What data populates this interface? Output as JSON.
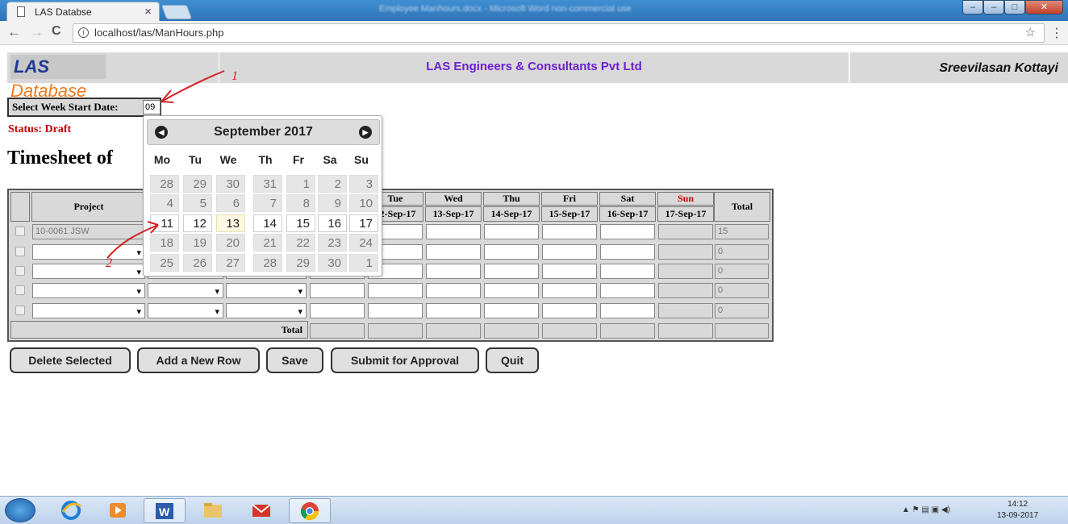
{
  "browser": {
    "tab_title": "LAS Databse",
    "tab_close": "×",
    "window_title": "Employee Manhours.docx - Microsoft Word non-commercial use",
    "url": "localhost/las/ManHours.php",
    "back": "←",
    "forward": "→",
    "reload": "C",
    "info": "i",
    "star": "☆",
    "menu": "⋮"
  },
  "header": {
    "logo_las": "LAS",
    "logo_db": "Database",
    "company": "LAS Engineers & Consultants Pvt Ltd",
    "user": "Sreevilasan Kottayi"
  },
  "week_selector": {
    "label": "Select Week Start Date:",
    "value": "09"
  },
  "status": "Status: Draft",
  "timesheet_title": "Timesheet of",
  "table": {
    "project_header": "Project",
    "days": [
      {
        "name": "Tue",
        "date": "12-Sep-17"
      },
      {
        "name": "Wed",
        "date": "13-Sep-17"
      },
      {
        "name": "Thu",
        "date": "14-Sep-17"
      },
      {
        "name": "Fri",
        "date": "15-Sep-17"
      },
      {
        "name": "Sat",
        "date": "16-Sep-17"
      },
      {
        "name": "Sun",
        "date": "17-Sep-17"
      }
    ],
    "total_header": "Total",
    "rows": [
      {
        "project": "10-0061 JSW",
        "total": "15"
      },
      {
        "project": "",
        "total": "0"
      },
      {
        "project": "",
        "total": "0"
      },
      {
        "project": "",
        "total": "0"
      },
      {
        "project": "",
        "total": "0"
      }
    ],
    "total_row_label": "Total",
    "sun_color": "#cc0000"
  },
  "buttons": {
    "delete": "Delete Selected",
    "add_row": "Add a New Row",
    "save": "Save",
    "submit": "Submit for Approval",
    "quit": "Quit"
  },
  "calendar": {
    "month_title": "September 2017",
    "prev_icon": "◀",
    "next_icon": "▶",
    "weekdays": [
      "Mo",
      "Tu",
      "We",
      "Th",
      "Fr",
      "Sa",
      "Su"
    ],
    "weeks": [
      [
        {
          "d": "28",
          "cur": false
        },
        {
          "d": "29",
          "cur": false
        },
        {
          "d": "30",
          "cur": false
        },
        {
          "d": "31",
          "cur": false
        },
        {
          "d": "1",
          "cur": false
        },
        {
          "d": "2",
          "cur": false
        },
        {
          "d": "3",
          "cur": false
        }
      ],
      [
        {
          "d": "4",
          "cur": false
        },
        {
          "d": "5",
          "cur": false
        },
        {
          "d": "6",
          "cur": false
        },
        {
          "d": "7",
          "cur": false
        },
        {
          "d": "8",
          "cur": false
        },
        {
          "d": "9",
          "cur": false
        },
        {
          "d": "10",
          "cur": false
        }
      ],
      [
        {
          "d": "11",
          "cur": true
        },
        {
          "d": "12",
          "cur": true
        },
        {
          "d": "13",
          "cur": true,
          "today": true
        },
        {
          "d": "14",
          "cur": true
        },
        {
          "d": "15",
          "cur": true
        },
        {
          "d": "16",
          "cur": true
        },
        {
          "d": "17",
          "cur": true
        }
      ],
      [
        {
          "d": "18",
          "cur": false
        },
        {
          "d": "19",
          "cur": false
        },
        {
          "d": "20",
          "cur": false
        },
        {
          "d": "21",
          "cur": false
        },
        {
          "d": "22",
          "cur": false
        },
        {
          "d": "23",
          "cur": false
        },
        {
          "d": "24",
          "cur": false
        }
      ],
      [
        {
          "d": "25",
          "cur": false
        },
        {
          "d": "26",
          "cur": false
        },
        {
          "d": "27",
          "cur": false
        },
        {
          "d": "28",
          "cur": false
        },
        {
          "d": "29",
          "cur": false
        },
        {
          "d": "30",
          "cur": false
        },
        {
          "d": "1",
          "cur": false
        }
      ]
    ]
  },
  "annotations": {
    "mark_1": "1",
    "mark_2": "2",
    "color": "#d42020"
  },
  "taskbar": {
    "clock_time": "14:12",
    "clock_date": "13-09-2017",
    "icons": [
      "start-orb-icon",
      "internet-explorer-icon",
      "media-player-icon",
      "word-icon",
      "file-explorer-icon",
      "mail-icon",
      "chrome-icon"
    ]
  }
}
